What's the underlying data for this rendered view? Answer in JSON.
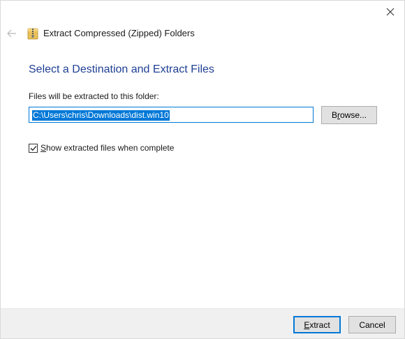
{
  "window": {
    "title": "Extract Compressed (Zipped) Folders"
  },
  "icons": {
    "close": "close-icon",
    "back": "back-arrow-icon",
    "zip": "zip-folder-icon",
    "checkbox": "checkmark-icon"
  },
  "main": {
    "heading": "Select a Destination and Extract Files",
    "field_label": "Files will be extracted to this folder:",
    "path_value": "C:\\Users\\chris\\Downloads\\dist.win10",
    "browse_prefix": "B",
    "browse_mnemonic": "r",
    "browse_suffix": "owse...",
    "checkbox_checked": true,
    "checkbox_mnemonic": "S",
    "checkbox_label_rest": "how extracted files when complete"
  },
  "footer": {
    "extract_mnemonic": "E",
    "extract_rest": "xtract",
    "cancel_label": "Cancel"
  },
  "colors": {
    "accent": "#0078d7",
    "heading": "#1f3f94",
    "footer_bg": "#f0f0f0",
    "button_bg": "#e1e1e1"
  }
}
